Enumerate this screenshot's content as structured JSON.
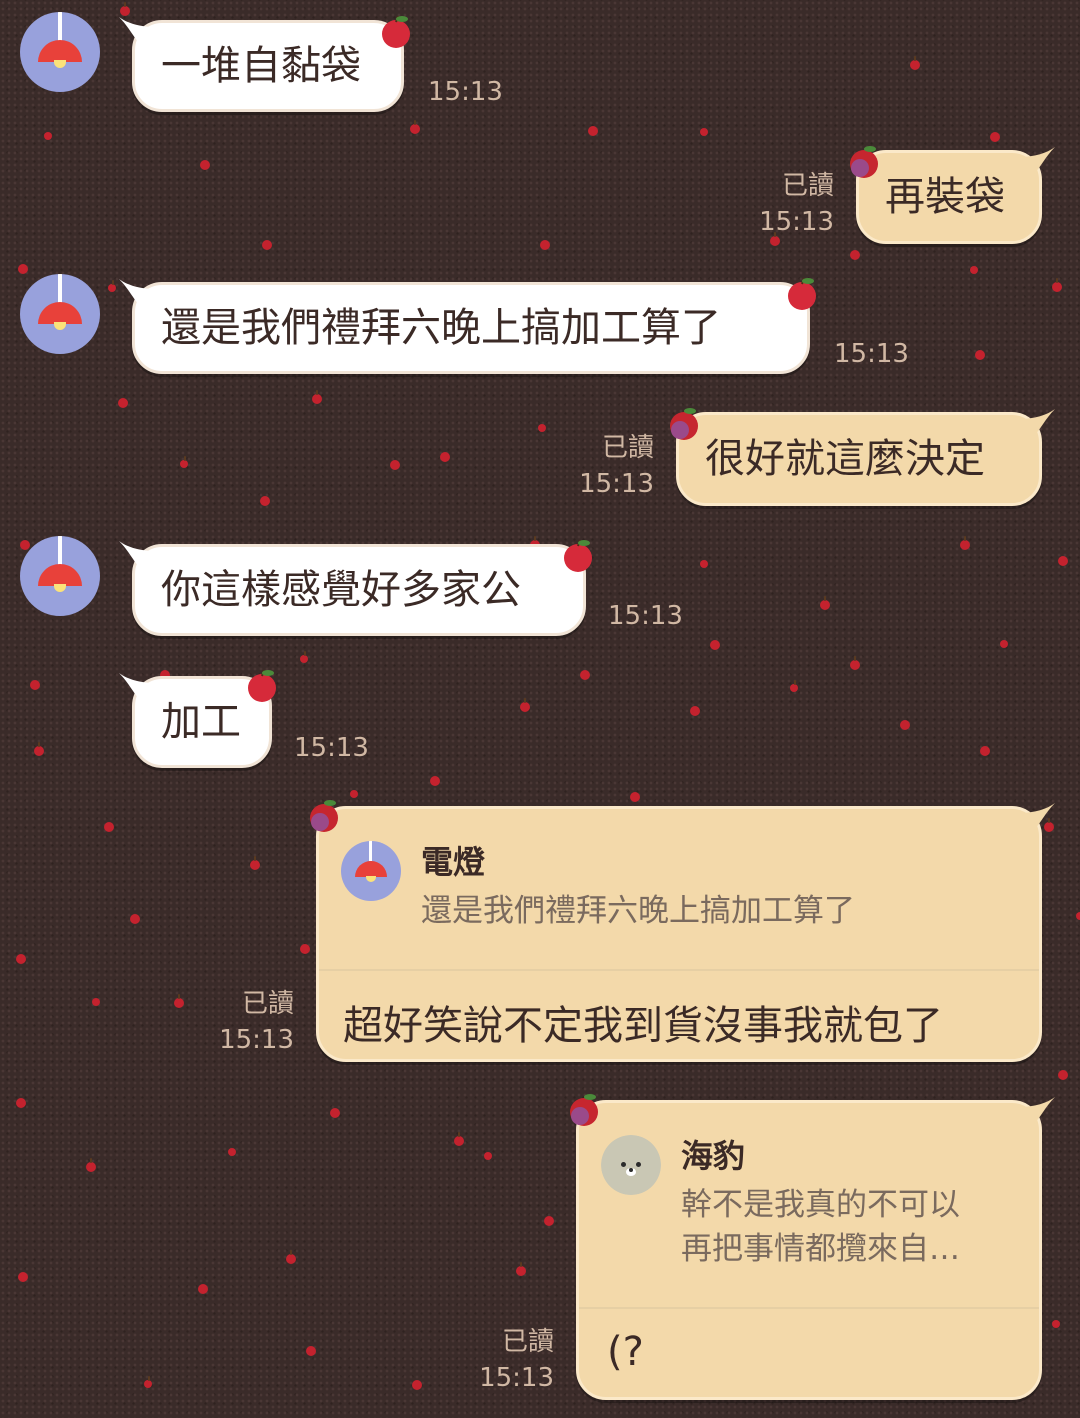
{
  "contact": {
    "name": "電燈",
    "avatar_icon": "lamp-icon"
  },
  "messages": [
    {
      "dir": "in",
      "text": "一堆自黏袋",
      "time": "15:13"
    },
    {
      "dir": "out",
      "text": "再裝袋",
      "read": "已讀",
      "time": "15:13"
    },
    {
      "dir": "in",
      "text": "還是我們禮拜六晚上搞加工算了",
      "time": "15:13"
    },
    {
      "dir": "out",
      "text": "很好就這麼決定",
      "read": "已讀",
      "time": "15:13"
    },
    {
      "dir": "in",
      "text": "你這樣感覺好多家公",
      "time": "15:13"
    },
    {
      "dir": "in",
      "text": "加工",
      "time": "15:13"
    },
    {
      "dir": "out",
      "reply_to": {
        "name": "電燈",
        "text": "還是我們禮拜六晚上搞加工算了",
        "avatar_icon": "lamp-icon"
      },
      "text": "超好笑說不定我到貨沒事我就包了",
      "read": "已讀",
      "time": "15:13"
    },
    {
      "dir": "out",
      "reply_to": {
        "name": "海豹",
        "text": "幹不是我真的不可以\n再把事情都攬來自…",
        "avatar_icon": "seal-icon"
      },
      "text": "(?",
      "read": "已讀",
      "time": "15:13"
    }
  ],
  "colors": {
    "incoming_bubble": "#ffffff",
    "outgoing_bubble": "#f3d9aa",
    "background": "#3a2b29",
    "meta_text": "#d1b8a4",
    "avatar_bg": "#98a1dc"
  },
  "decoration_icon": "apple-icon"
}
